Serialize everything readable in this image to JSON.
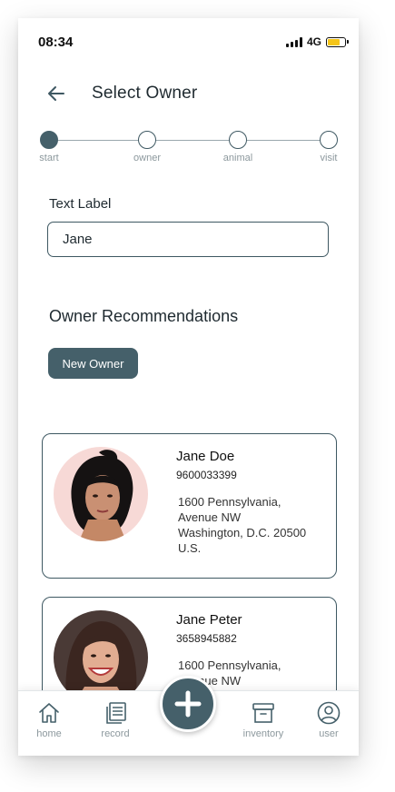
{
  "status_bar": {
    "time": "08:34",
    "network": "4G"
  },
  "header": {
    "title": "Select Owner"
  },
  "stepper": {
    "steps": [
      "start",
      "owner",
      "animal",
      "visit"
    ],
    "active_index": 0
  },
  "form": {
    "label": "Text Label",
    "value": "Jane"
  },
  "recommendations": {
    "title": "Owner Recommendations",
    "new_owner_label": "New Owner",
    "owners": [
      {
        "name": "Jane Doe",
        "phone": "9600033399",
        "address_lines": [
          "1600 Pennsylvania,",
          "Avenue NW",
          "Washington, D.C. 20500",
          "U.S."
        ]
      },
      {
        "name": "Jane Peter",
        "phone": "3658945882",
        "address_lines": [
          "1600 Pennsylvania,",
          "Avenue NW"
        ]
      }
    ]
  },
  "bottom_nav": {
    "items": [
      {
        "label": "home",
        "icon": "home-icon"
      },
      {
        "label": "record",
        "icon": "record-icon"
      },
      {
        "label": "inventory",
        "icon": "inventory-icon"
      },
      {
        "label": "user",
        "icon": "user-icon"
      }
    ],
    "fab_icon": "plus-icon"
  },
  "colors": {
    "accent": "#45606a",
    "border": "#3e5862",
    "battery": "#f5c518"
  }
}
